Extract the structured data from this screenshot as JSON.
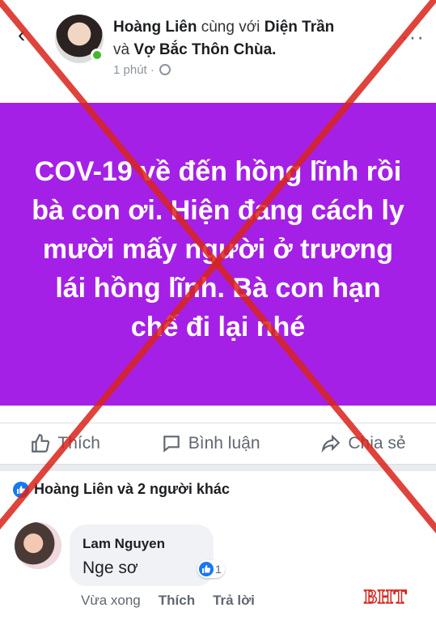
{
  "post": {
    "author": "Hoàng Liên",
    "with_word": "cùng với",
    "tagged_1": "Diện Trần",
    "and_word": "và",
    "tagged_2": "Vợ Bắc Thôn Chùa.",
    "time": "1 phút ·",
    "privacy_icon": "globe-icon",
    "more_label": "···",
    "back_label": "‹",
    "background": "#a520e6",
    "text": "COV-19 về đến hồng lĩnh rồi bà con ơi. Hiện đang cách ly mười mấy người ở trương lái hồng lĩnh. Bà con hạn chế đi lại nhé"
  },
  "actions": {
    "like": "Thích",
    "comment": "Bình luận",
    "share": "Chia sẻ"
  },
  "reactions": {
    "summary": "Hoàng Liên và 2 người khác"
  },
  "comment": {
    "author": "Lam Nguyen",
    "text": "Nge sơ",
    "like_count": "1",
    "time": "Vừa xong",
    "like_action": "Thích",
    "reply_action": "Trả lời"
  },
  "watermark": "BHT",
  "colors": {
    "accent": "#1877f2",
    "cross": "#d9241b",
    "online": "#42b72a"
  }
}
